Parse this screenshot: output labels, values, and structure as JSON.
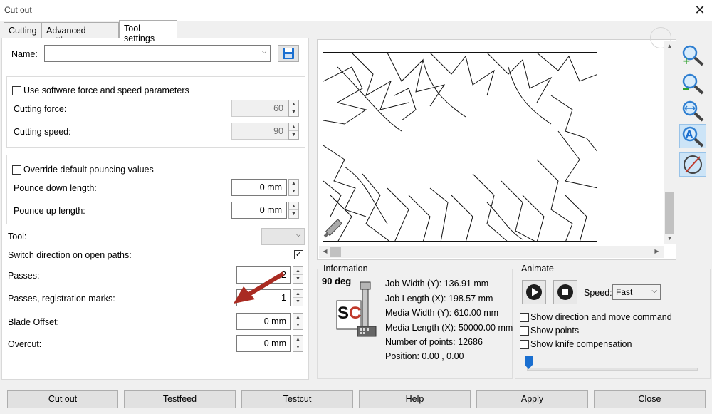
{
  "window": {
    "title": "Cut out",
    "close_glyph": "✕"
  },
  "tabs": [
    {
      "label": "Cutting",
      "active": false
    },
    {
      "label": "Advanced settings",
      "active": false
    },
    {
      "label": "Tool settings",
      "active": true
    }
  ],
  "tool_settings": {
    "name_label": "Name:",
    "name_value": "",
    "save_icon": "floppy-disk-icon",
    "force_speed": {
      "checkbox_label": "Use software force and speed parameters",
      "checked": false,
      "force_label": "Cutting force:",
      "force_value": "60",
      "speed_label": "Cutting speed:",
      "speed_value": "90"
    },
    "pouncing": {
      "checkbox_label": "Override default pouncing values",
      "checked": false,
      "down_label": "Pounce down length:",
      "down_value": "0 mm",
      "up_label": "Pounce up length:",
      "up_value": "0 mm"
    },
    "tool_label": "Tool:",
    "tool_value": "",
    "switch_label": "Switch direction on open paths:",
    "switch_checked": true,
    "passes_label": "Passes:",
    "passes_value": "2",
    "passes_reg_label": "Passes, registration marks:",
    "passes_reg_value": "1",
    "blade_offset_label": "Blade Offset:",
    "blade_offset_value": "0 mm",
    "overcut_label": "Overcut:",
    "overcut_value": "0 mm"
  },
  "side_tools": [
    "zoom-in-icon",
    "zoom-out-icon",
    "zoom-fit-width-icon",
    "auto-zoom-icon",
    "no-symbol-icon"
  ],
  "information": {
    "title": "Information",
    "angle": "90 deg",
    "logo_text": "SC",
    "lines": [
      "Job Width (Y): 136.91 mm",
      "Job Length (X): 198.57 mm",
      "Media Width (Y): 610.00 mm",
      "Media Length (X): 50000.00 mm",
      "Number of points: 12686",
      "Position: 0.00 , 0.00"
    ]
  },
  "animate": {
    "title": "Animate",
    "speed_label": "Speed:",
    "speed_value": "Fast",
    "options": [
      {
        "label": "Show direction and move command",
        "checked": false
      },
      {
        "label": "Show points",
        "checked": false
      },
      {
        "label": "Show knife compensation",
        "checked": false
      }
    ],
    "slider_position": 0
  },
  "buttons": [
    "Cut out",
    "Testfeed",
    "Testcut",
    "Help",
    "Apply",
    "Close"
  ],
  "colors": {
    "accent_blue": "#1a6fd0",
    "annotation_arrow": "#a92b22",
    "pressed_tool": "#cce4f7"
  }
}
